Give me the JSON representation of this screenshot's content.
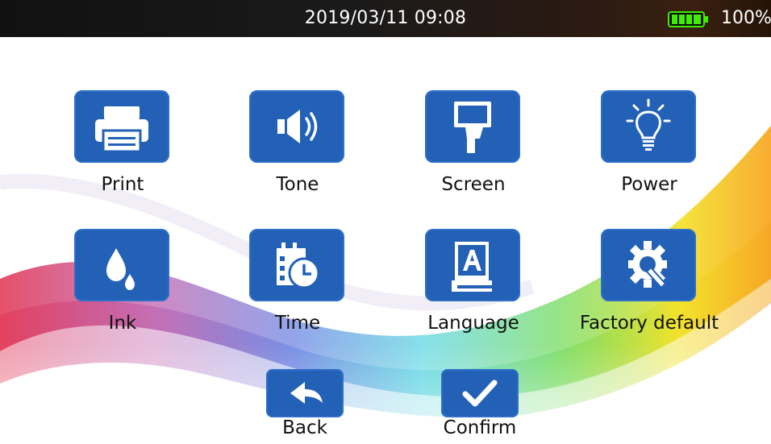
{
  "status_bar": {
    "datetime": "2019/03/11 09:08",
    "battery_percent": "100%",
    "battery_level": 1.0
  },
  "menu": {
    "items": [
      {
        "label": "Print",
        "icon": "printer-icon"
      },
      {
        "label": "Tone",
        "icon": "speaker-icon"
      },
      {
        "label": "Screen",
        "icon": "handheld-screen-icon"
      },
      {
        "label": "Power",
        "icon": "lightbulb-icon"
      },
      {
        "label": "Ink",
        "icon": "ink-drops-icon"
      },
      {
        "label": "Time",
        "icon": "clock-calendar-icon"
      },
      {
        "label": "Language",
        "icon": "language-book-icon"
      },
      {
        "label": "Factory default",
        "icon": "gear-wrench-icon"
      }
    ]
  },
  "actions": {
    "back_label": "Back",
    "back_icon": "back-arrow-icon",
    "confirm_label": "Confirm",
    "confirm_icon": "checkmark-icon"
  },
  "colors": {
    "tile_blue": "#2361b6",
    "status_bar": "#141414",
    "battery_green": "#3cf000"
  }
}
